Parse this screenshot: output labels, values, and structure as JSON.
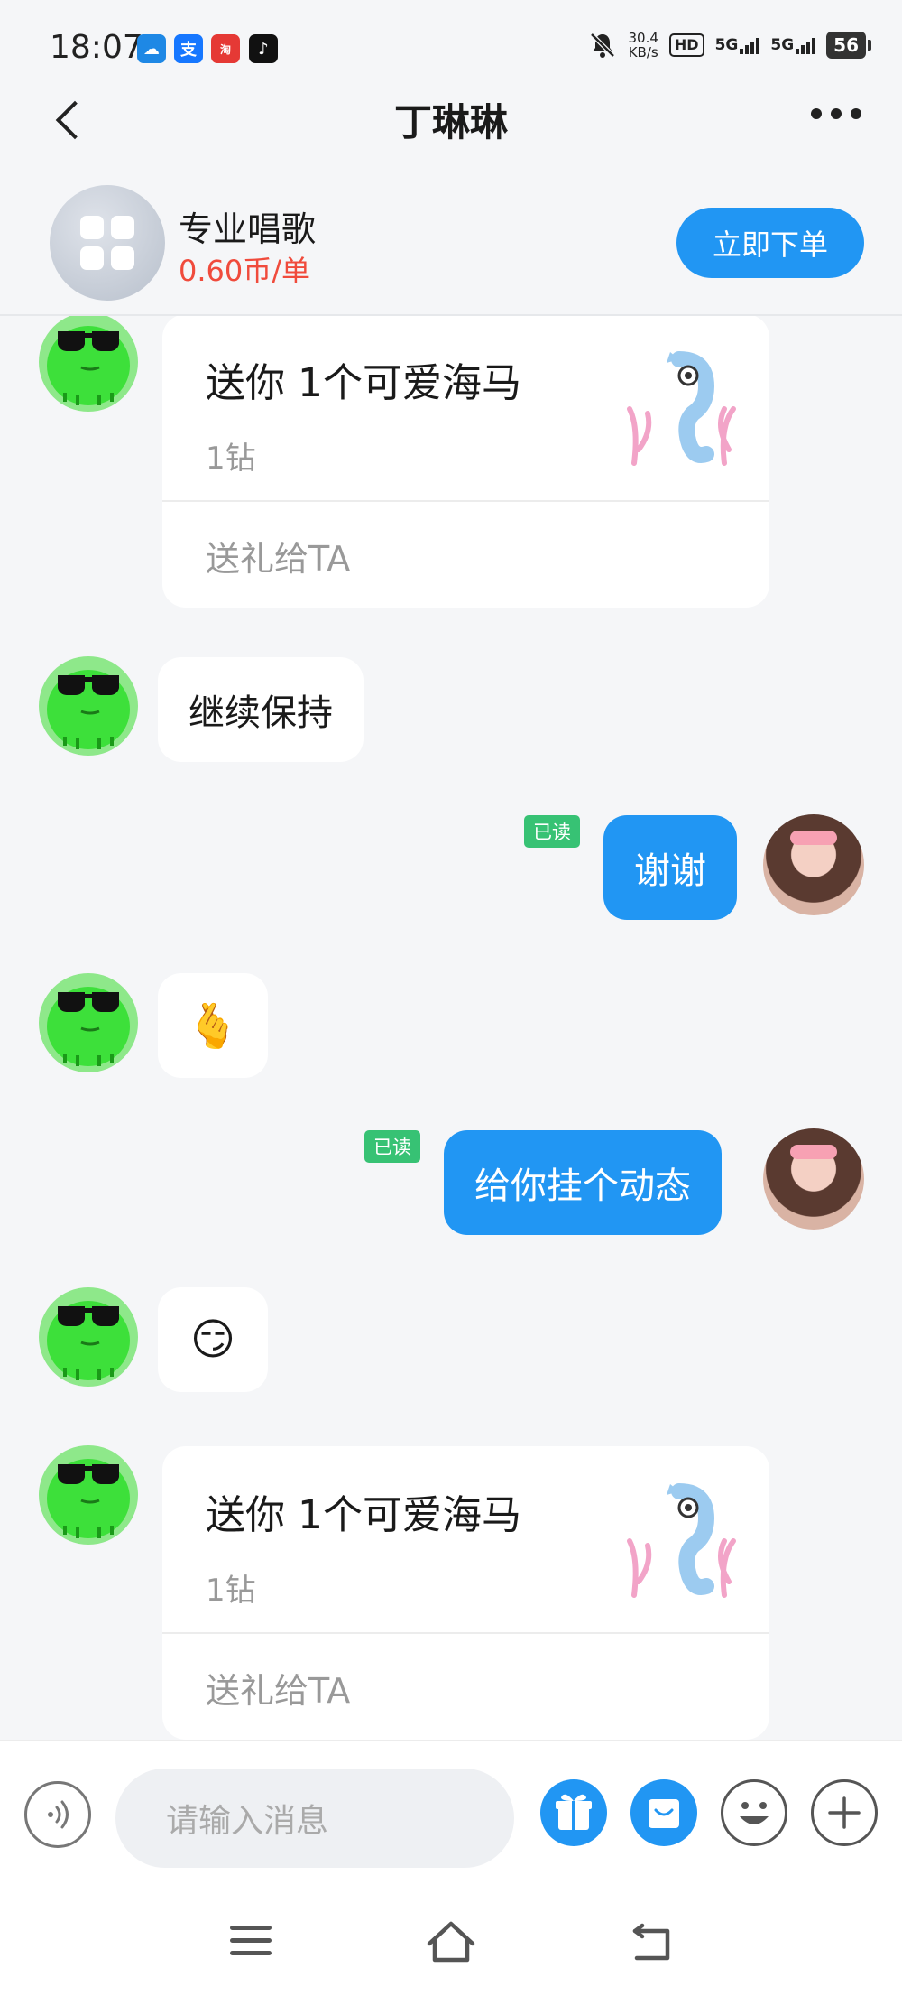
{
  "status_bar": {
    "time": "18:07",
    "net_speed_value": "30.4",
    "net_speed_unit": "KB/s",
    "hd_label": "HD",
    "signal1": "5G",
    "signal2": "5G",
    "battery": "56",
    "app_icons": [
      "baidu-netdisk-icon",
      "alipay-icon",
      "taobao-icon",
      "tiktok-icon"
    ]
  },
  "header": {
    "title": "丁琳琳"
  },
  "service": {
    "name": "专业唱歌",
    "price": "0.60币/单",
    "order_button": "立即下单"
  },
  "messages": [
    {
      "type": "gift",
      "side": "left",
      "title": "送你 1个可爱海马",
      "amount": "1钻",
      "action": "送礼给TA"
    },
    {
      "type": "text",
      "side": "left",
      "text": "继续保持"
    },
    {
      "type": "text",
      "side": "right",
      "text": "谢谢",
      "read": "已读"
    },
    {
      "type": "emoji",
      "side": "left",
      "emoji": "🫰"
    },
    {
      "type": "text",
      "side": "right",
      "text": "给你挂个动态",
      "read": "已读"
    },
    {
      "type": "emoji",
      "side": "left",
      "emoji": "😏"
    },
    {
      "type": "gift",
      "side": "left",
      "title": "送你 1个可爱海马",
      "amount": "1钻",
      "action": "送礼给TA"
    }
  ],
  "input_bar": {
    "placeholder": "请输入消息"
  },
  "colors": {
    "accent": "#2196f3",
    "price": "#f04b3c",
    "read_badge": "#37c274",
    "frog_green": "#3de03a"
  }
}
